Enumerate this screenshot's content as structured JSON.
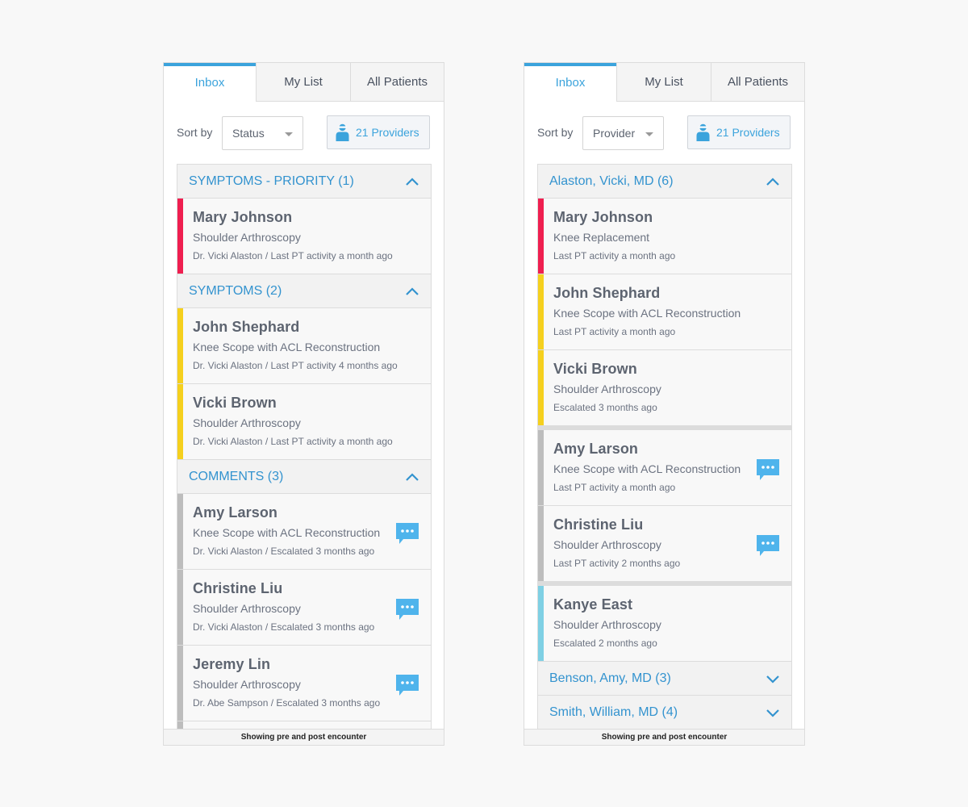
{
  "colors": {
    "accent": "#3ba3dc",
    "priority": "#ef1f50",
    "symptom": "#f5d01e",
    "comment": "#bdbdbd",
    "other": "#7fd0e4"
  },
  "left": {
    "tabs": [
      "Inbox",
      "My List",
      "All Patients"
    ],
    "sort_label": "Sort by",
    "sort_value": "Status",
    "providers_label": "21 Providers",
    "groups": [
      {
        "title": "SYMPTOMS - PRIORITY (1)",
        "items": [
          {
            "name": "Mary Johnson",
            "procedure": "Shoulder Arthroscopy",
            "meta": "Dr. Vicki Alaston / Last PT activity a month ago"
          }
        ]
      },
      {
        "title": "SYMPTOMS (2)",
        "items": [
          {
            "name": "John Shephard",
            "procedure": "Knee Scope with ACL Reconstruction",
            "meta": "Dr. Vicki Alaston / Last PT activity 4 months ago"
          },
          {
            "name": "Vicki Brown",
            "procedure": "Shoulder Arthroscopy",
            "meta": "Dr. Vicki Alaston / Last PT activity a month ago"
          }
        ]
      },
      {
        "title": "COMMENTS (3)",
        "items": [
          {
            "name": "Amy Larson",
            "procedure": "Knee Scope with ACL Reconstruction",
            "meta": "Dr. Vicki Alaston / Escalated 3 months ago"
          },
          {
            "name": "Christine Liu",
            "procedure": "Shoulder Arthroscopy",
            "meta": "Dr. Vicki Alaston / Escalated 3 months ago"
          },
          {
            "name": "Jeremy Lin",
            "procedure": "Shoulder Arthroscopy",
            "meta": "Dr. Abe Sampson / Escalated 3 months ago"
          }
        ]
      }
    ],
    "footer": "Showing pre and post encounter"
  },
  "right": {
    "tabs": [
      "Inbox",
      "My List",
      "All Patients"
    ],
    "sort_label": "Sort by",
    "sort_value": "Provider",
    "providers_label": "21 Providers",
    "group1": {
      "title": "Alaston, Vicki, MD (6)",
      "items": [
        {
          "name": "Mary Johnson",
          "procedure": "Knee Replacement",
          "meta": "Last PT activity a month ago"
        },
        {
          "name": "John Shephard",
          "procedure": "Knee Scope with ACL Reconstruction",
          "meta": "Last PT activity a month ago"
        },
        {
          "name": "Vicki Brown",
          "procedure": "Shoulder Arthroscopy",
          "meta": "Escalated 3 months ago"
        },
        {
          "name": "Amy Larson",
          "procedure": "Knee Scope with ACL Reconstruction",
          "meta": "Last PT activity a month ago"
        },
        {
          "name": "Christine Liu",
          "procedure": "Shoulder Arthroscopy",
          "meta": "Last PT activity 2 months ago"
        },
        {
          "name": "Kanye East",
          "procedure": "Shoulder Arthroscopy",
          "meta": "Escalated 2 months ago"
        }
      ]
    },
    "group2": {
      "title": "Benson, Amy, MD (3)"
    },
    "group3": {
      "title": "Smith, William, MD (4)"
    },
    "footer": "Showing pre and post encounter"
  },
  "icons": {
    "provider": "doctor-icon",
    "comment": "chat-bubble-icon",
    "collapse": "chevron-up-icon",
    "expand": "chevron-down-icon",
    "dropdown": "caret-down-icon"
  }
}
